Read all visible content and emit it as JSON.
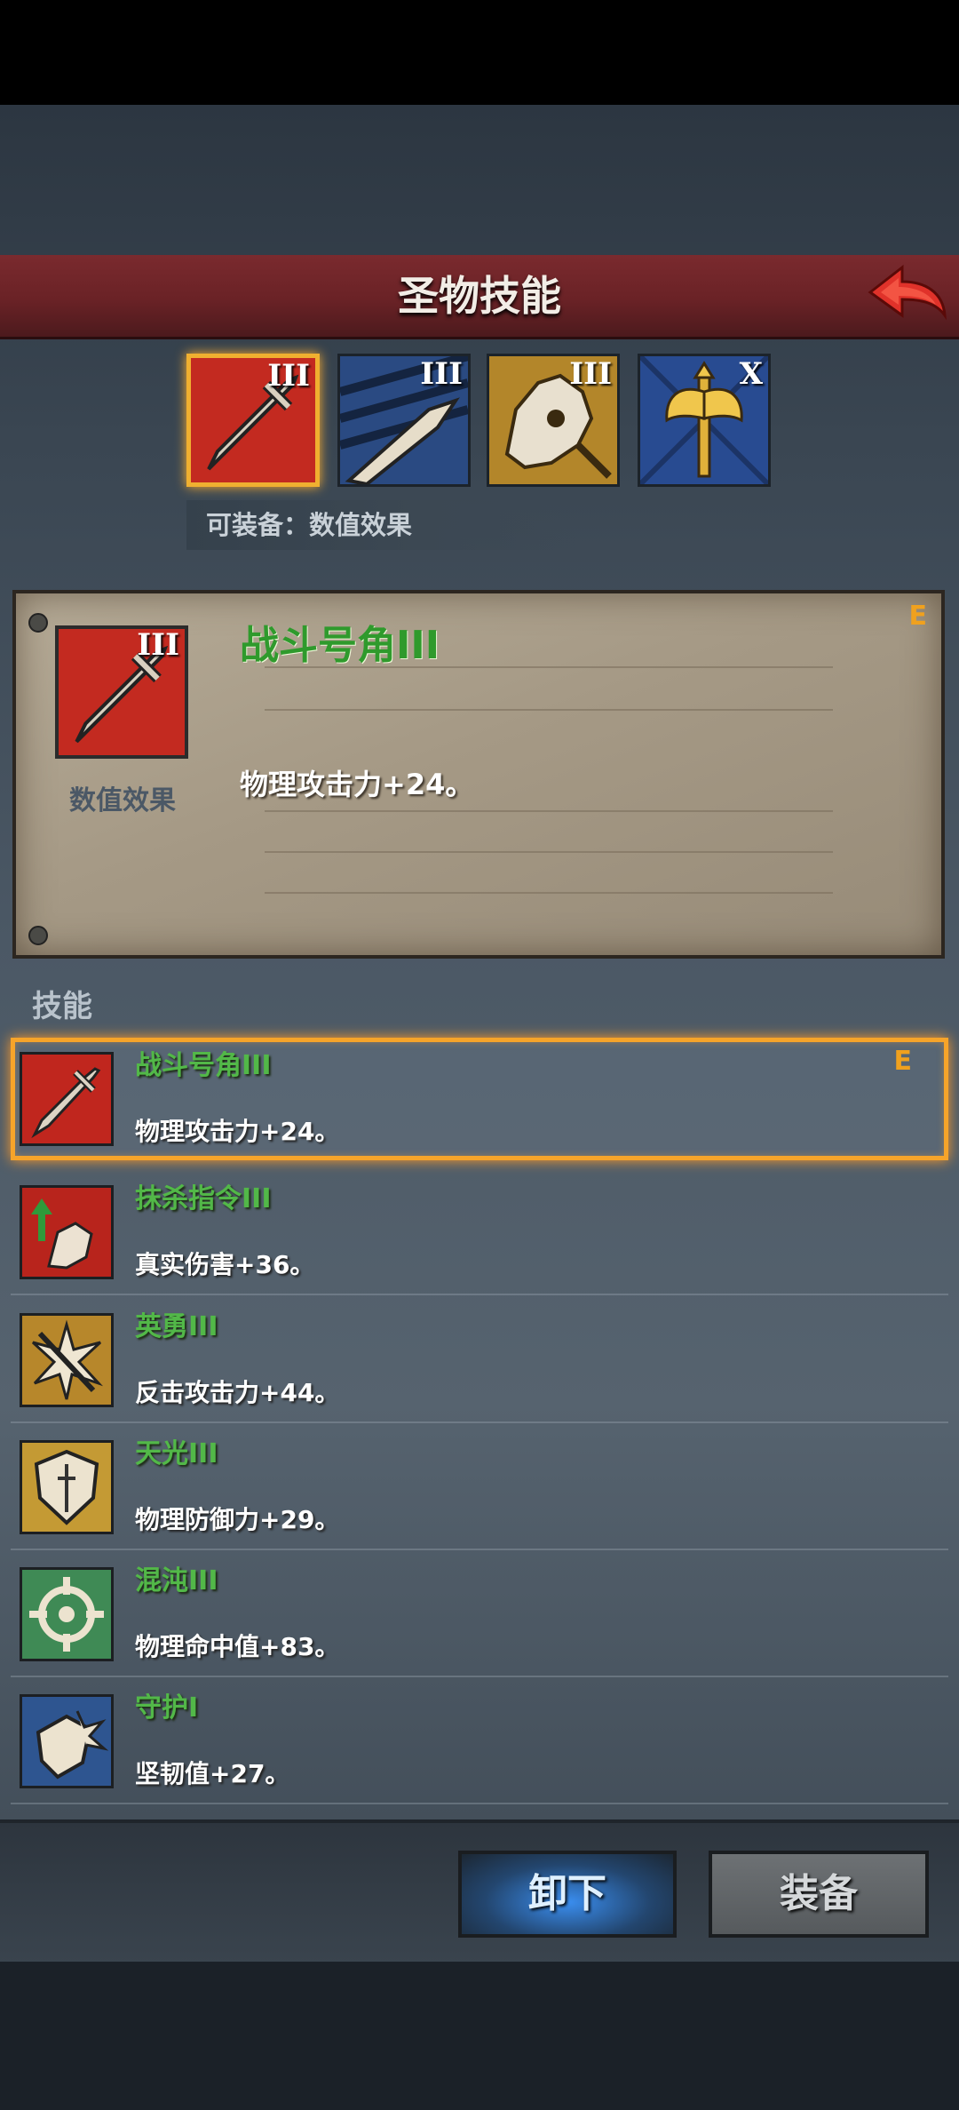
{
  "header": {
    "title": "圣物技能"
  },
  "relics": [
    {
      "level": "III",
      "icon": "red-sword-icon",
      "color": "#c32a20",
      "selected": true
    },
    {
      "level": "III",
      "icon": "blue-claw-icon",
      "color": "#2a4a82",
      "selected": false
    },
    {
      "level": "III",
      "icon": "gold-beast-icon",
      "color": "#b3862a",
      "selected": false
    },
    {
      "level": "X",
      "icon": "blue-golden-axe-icon",
      "color": "#284b91",
      "selected": false
    }
  ],
  "equip_type": "可装备：数值效果",
  "detail": {
    "level": "III",
    "type": "数值效果",
    "name": "战斗号角III",
    "effect": "物理攻击力+24。",
    "badge": "E"
  },
  "section_label": "技能",
  "skills": [
    {
      "name": "战斗号角III",
      "desc": "物理攻击力+24。",
      "icon": "sword-icon",
      "color": "#c0261e",
      "badge": "E",
      "selected": true
    },
    {
      "name": "抹杀指令III",
      "desc": "真实伤害+36。",
      "icon": "fist-arrow-icon",
      "color": "#b8241c"
    },
    {
      "name": "英勇III",
      "desc": "反击攻击力+44。",
      "icon": "starburst-arrow-icon",
      "color": "#b7872b"
    },
    {
      "name": "天光III",
      "desc": "物理防御力+29。",
      "icon": "shield-icon",
      "color": "#c49a34"
    },
    {
      "name": "混沌III",
      "desc": "物理命中值+83。",
      "icon": "crosshair-icon",
      "color": "#3f8a55"
    },
    {
      "name": "守护I",
      "desc": "坚韧值+27。",
      "icon": "broken-shield-icon",
      "color": "#2e5590"
    }
  ],
  "buttons": {
    "unequip": "卸下",
    "equip": "装备"
  }
}
